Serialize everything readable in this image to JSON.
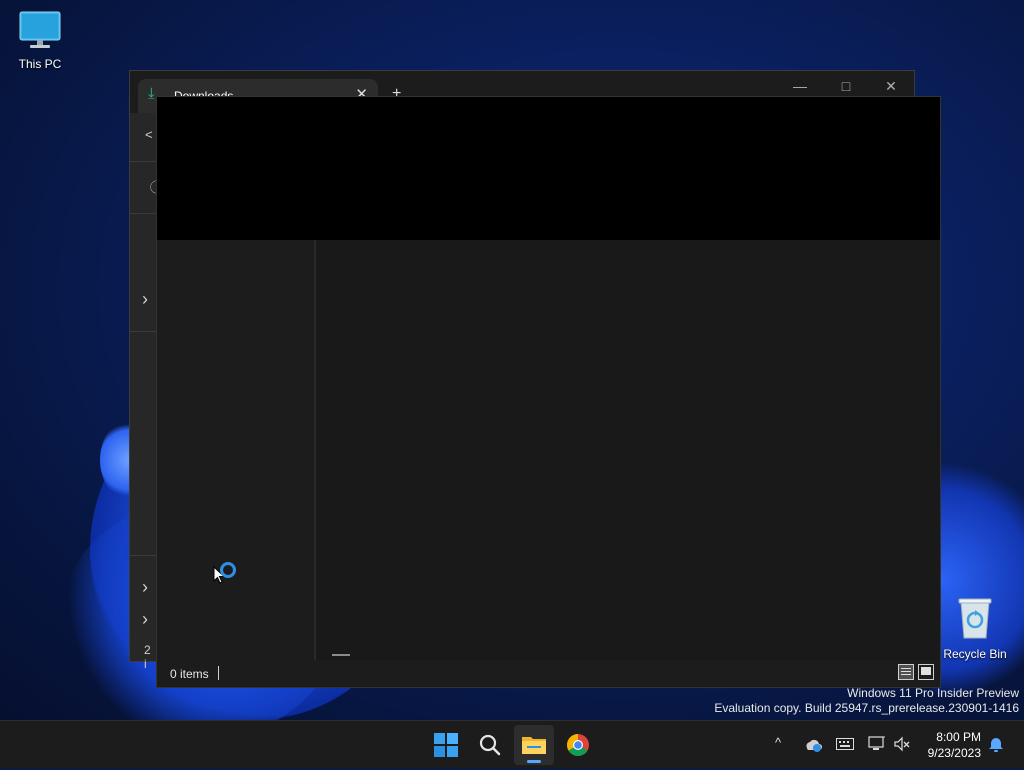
{
  "desktop": {
    "icons": [
      {
        "label": "This PC"
      },
      {
        "label": "Recycle Bin"
      }
    ],
    "watermark": {
      "line1": "Windows 11 Pro Insider Preview",
      "line2": "Evaluation copy. Build 25947.rs_prerelease.230901-1416"
    }
  },
  "explorer_back": {
    "tab_title": "Downloads",
    "tab_close_glyph": "✕",
    "new_tab_glyph": "+",
    "controls": {
      "minimize": "—",
      "maximize": "□",
      "close": "✕"
    },
    "rail_glyphs": {
      "back": "<",
      "info": "ⓘ",
      "chevron": "›"
    },
    "status_partial": "2 i"
  },
  "explorer_front": {
    "status": {
      "item_count": "0 items"
    }
  },
  "taskbar": {
    "tray": {
      "chevron_glyph": "^",
      "time": "8:00 PM",
      "date": "9/23/2023"
    }
  },
  "colors": {
    "accent": "#2f8fe6",
    "download_green": "#2fc07e",
    "taskbar_bg": "#1c1c1c",
    "window_bg": "#1b1b1b"
  },
  "icons": [
    "monitor-icon",
    "recycle-bin-icon",
    "download-icon",
    "close-icon",
    "plus-icon",
    "minimize-icon",
    "maximize-icon",
    "back-arrow-icon",
    "info-icon",
    "chevron-right-icon",
    "details-view-icon",
    "tiles-view-icon",
    "cursor-icon",
    "loading-spinner-icon",
    "windows-start-icon",
    "search-icon",
    "file-explorer-icon",
    "chrome-icon",
    "onedrive-icon",
    "keyboard-icon",
    "network-icon",
    "volume-muted-icon",
    "notification-bell-icon"
  ]
}
